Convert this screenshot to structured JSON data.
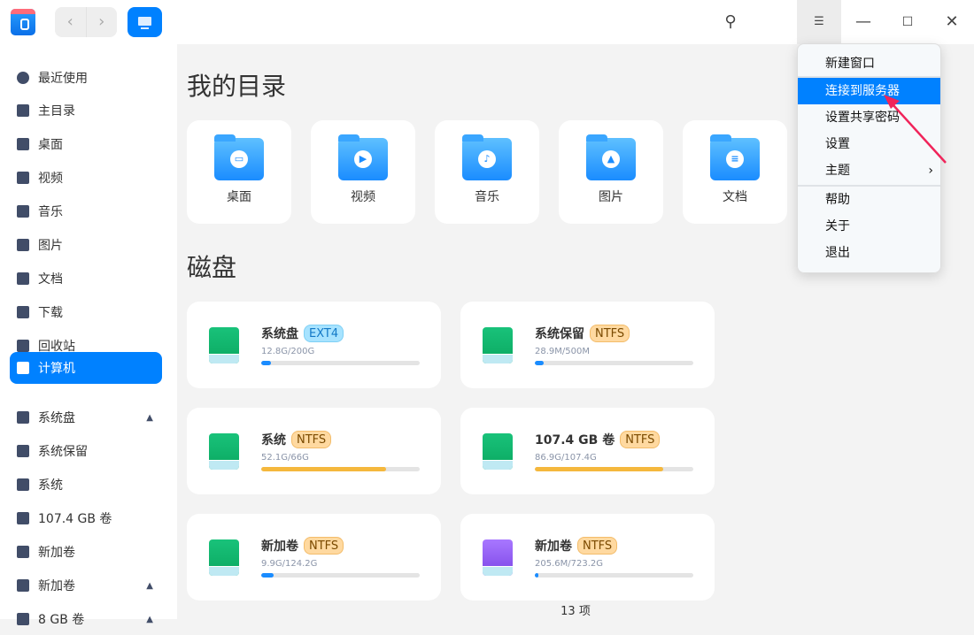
{
  "sidebar": {
    "items": [
      {
        "label": "最近使用",
        "icon": "clock-icon"
      },
      {
        "label": "主目录",
        "icon": "home-icon"
      },
      {
        "label": "桌面",
        "icon": "desktop-icon"
      },
      {
        "label": "视频",
        "icon": "video-icon"
      },
      {
        "label": "音乐",
        "icon": "music-icon"
      },
      {
        "label": "图片",
        "icon": "picture-icon"
      },
      {
        "label": "文档",
        "icon": "document-icon"
      },
      {
        "label": "下载",
        "icon": "download-icon"
      },
      {
        "label": "回收站",
        "icon": "trash-icon"
      },
      {
        "label": "计算机",
        "icon": "computer-icon"
      },
      {
        "label": "系统盘",
        "icon": "disk-icon"
      },
      {
        "label": "系统保留",
        "icon": "disk-icon"
      },
      {
        "label": "系统",
        "icon": "disk-icon"
      },
      {
        "label": "107.4 GB 卷",
        "icon": "disk-icon"
      },
      {
        "label": "新加卷",
        "icon": "disk-icon"
      },
      {
        "label": "新加卷",
        "icon": "usb-icon"
      },
      {
        "label": "8 GB 卷",
        "icon": "usb-icon"
      }
    ]
  },
  "main": {
    "my_dirs_title": "我的目录",
    "folders": [
      {
        "label": "桌面",
        "glyph": "▭"
      },
      {
        "label": "视频",
        "glyph": "▶"
      },
      {
        "label": "音乐",
        "glyph": "♪"
      },
      {
        "label": "图片",
        "glyph": "▲"
      },
      {
        "label": "文档",
        "glyph": "≡"
      }
    ],
    "disks_title": "磁盘",
    "disks": [
      {
        "name": "系统盘",
        "fs": "EXT4",
        "size": "12.8G/200G",
        "usage": 6.4,
        "color": "#1a8cff"
      },
      {
        "name": "系统保留",
        "fs": "NTFS",
        "size": "28.9M/500M",
        "usage": 5.8,
        "color": "#1a8cff"
      },
      {
        "name": "系统",
        "fs": "NTFS",
        "size": "52.1G/66G",
        "usage": 79,
        "color": "#f5b83d"
      },
      {
        "name": "107.4 GB 卷",
        "fs": "NTFS",
        "size": "86.9G/107.4G",
        "usage": 81,
        "color": "#f5b83d"
      },
      {
        "name": "新加卷",
        "fs": "NTFS",
        "size": "9.9G/124.2G",
        "usage": 8,
        "color": "#1a8cff"
      },
      {
        "name": "新加卷",
        "fs": "NTFS",
        "size": "205.6M/723.2G",
        "usage": 1,
        "color": "#1a8cff"
      }
    ]
  },
  "status": "13 项",
  "menu": {
    "items": [
      "新建窗口",
      "连接到服务器",
      "设置共享密码",
      "设置",
      "主题",
      "帮助",
      "关于",
      "退出"
    ]
  }
}
